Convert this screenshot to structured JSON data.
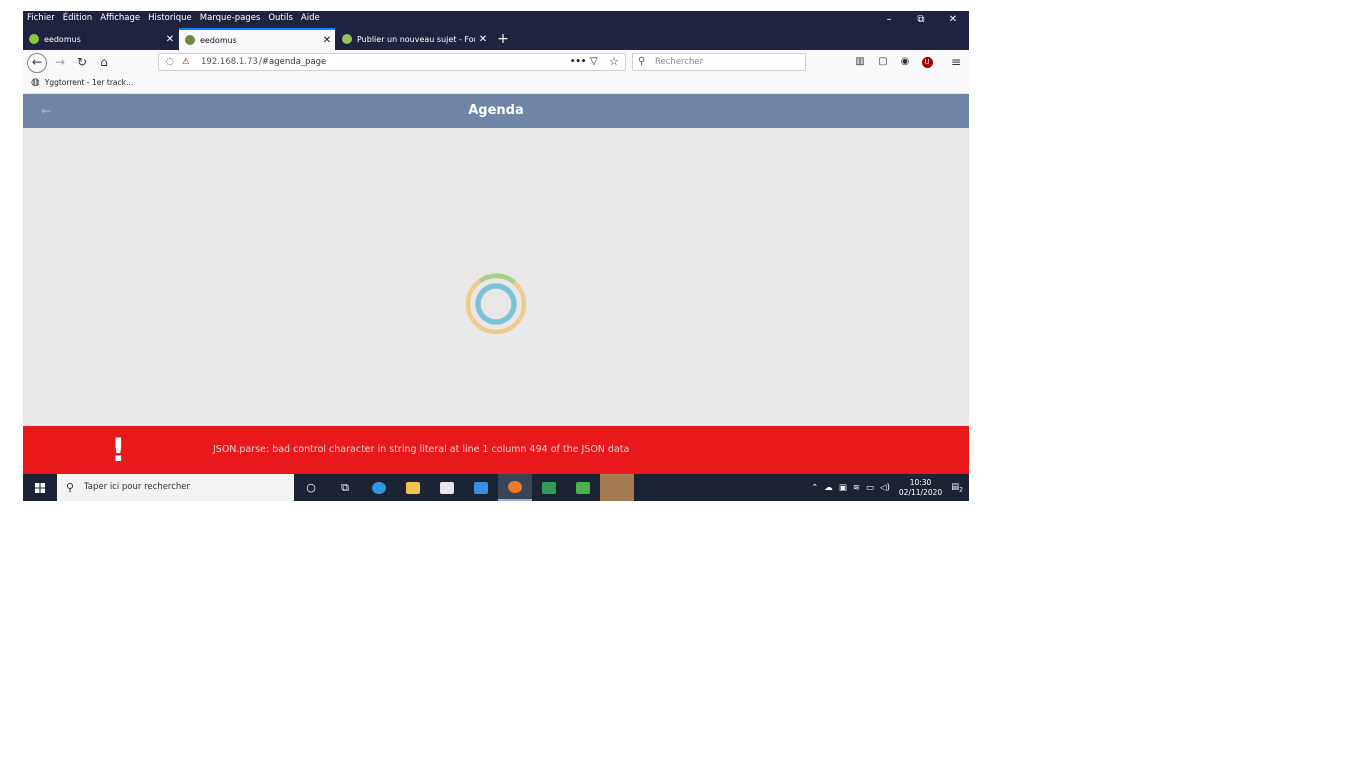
{
  "menubar": {
    "items": [
      "Fichier",
      "Édition",
      "Affichage",
      "Historique",
      "Marque-pages",
      "Outils",
      "Aide"
    ],
    "window_controls": [
      "–",
      "⧉",
      "✕"
    ]
  },
  "tabs": [
    {
      "title": "eedomus",
      "active": false,
      "close": "✕"
    },
    {
      "title": "eedomus",
      "active": true,
      "close": "✕"
    },
    {
      "title": "Publier un nouveau sujet - Foru",
      "active": false,
      "close": "✕"
    }
  ],
  "new_tab_label": "+",
  "nav": {
    "back": "←",
    "forward": "→",
    "reload": "↻",
    "home": "⌂",
    "url": {
      "host": "192.168.1.73",
      "path": "/#agenda_page"
    },
    "page_actions": "•••",
    "search_placeholder": "Rechercher"
  },
  "bookmarks": [
    {
      "label": "Yggtorrent - 1er track..."
    }
  ],
  "app": {
    "back_arrow": "←",
    "title": "Agenda",
    "spinner_colors": {
      "outer": "#edc98a",
      "outer_top": "#a6cf8e",
      "inner": "#7ec3d6"
    }
  },
  "error": {
    "icon": "!",
    "message": "JSON.parse: bad control character in string literal at line 1 column 494 of the JSON data",
    "color": "#e8181b"
  },
  "taskbar": {
    "search_placeholder": "Taper ici pour rechercher",
    "time": "10:30",
    "date": "02/11/2020",
    "notifications": "2"
  }
}
